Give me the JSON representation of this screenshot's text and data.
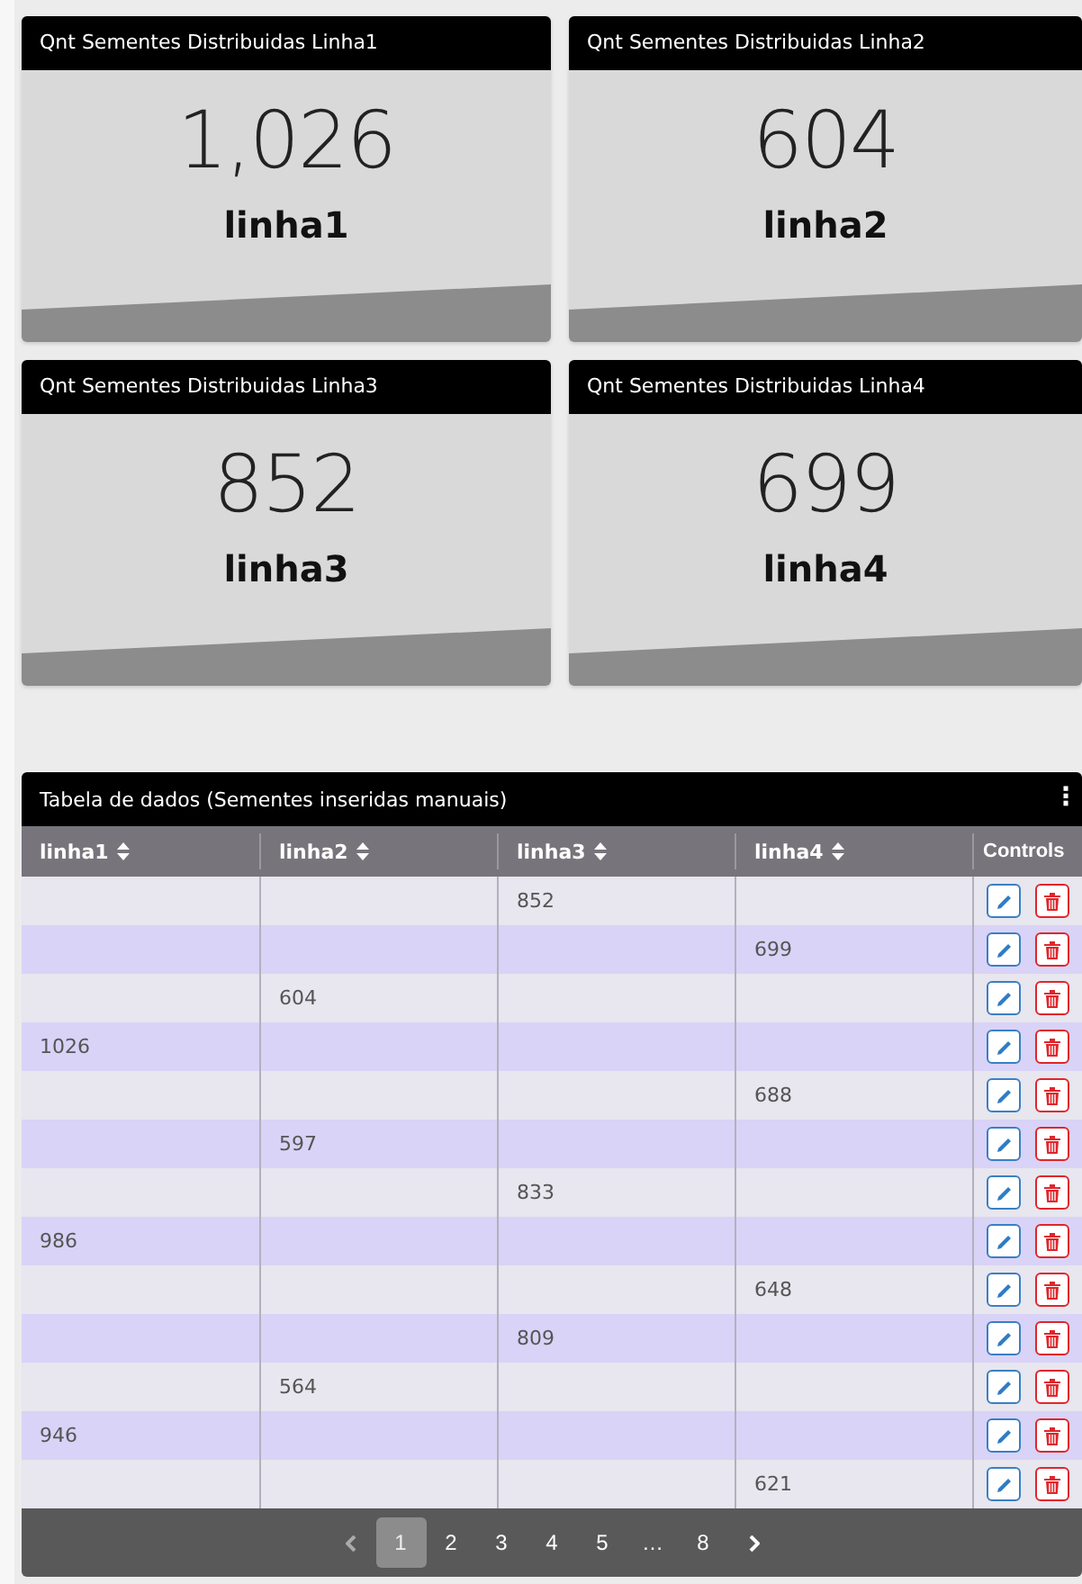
{
  "cards": [
    {
      "title": "Qnt Sementes Distribuidas Linha1",
      "value": "1,026",
      "label": "linha1"
    },
    {
      "title": "Qnt Sementes Distribuidas Linha2",
      "value": "604",
      "label": "linha2"
    },
    {
      "title": "Qnt Sementes Distribuidas Linha3",
      "value": "852",
      "label": "linha3"
    },
    {
      "title": "Qnt Sementes Distribuidas Linha4",
      "value": "699",
      "label": "linha4"
    }
  ],
  "table": {
    "title": "Tabela de dados (Sementes inseridas manuais)",
    "menu_icon": "⋮",
    "columns": [
      "linha1",
      "linha2",
      "linha3",
      "linha4"
    ],
    "controls_column": "Controls",
    "rows": [
      [
        null,
        null,
        "852",
        null
      ],
      [
        null,
        null,
        null,
        "699"
      ],
      [
        null,
        "604",
        null,
        null
      ],
      [
        "1026",
        null,
        null,
        null
      ],
      [
        null,
        null,
        null,
        "688"
      ],
      [
        null,
        "597",
        null,
        null
      ],
      [
        null,
        null,
        "833",
        null
      ],
      [
        "986",
        null,
        null,
        null
      ],
      [
        null,
        null,
        null,
        "648"
      ],
      [
        null,
        null,
        "809",
        null
      ],
      [
        null,
        "564",
        null,
        null
      ],
      [
        "946",
        null,
        null,
        null
      ],
      [
        null,
        null,
        null,
        "621"
      ]
    ]
  },
  "pagination": {
    "pages": [
      {
        "label": "1",
        "selected": true
      },
      {
        "label": "2",
        "selected": false
      },
      {
        "label": "3",
        "selected": false
      },
      {
        "label": "4",
        "selected": false
      },
      {
        "label": "5",
        "selected": false
      },
      {
        "label": "…",
        "selected": false
      },
      {
        "label": "8",
        "selected": false
      }
    ]
  }
}
